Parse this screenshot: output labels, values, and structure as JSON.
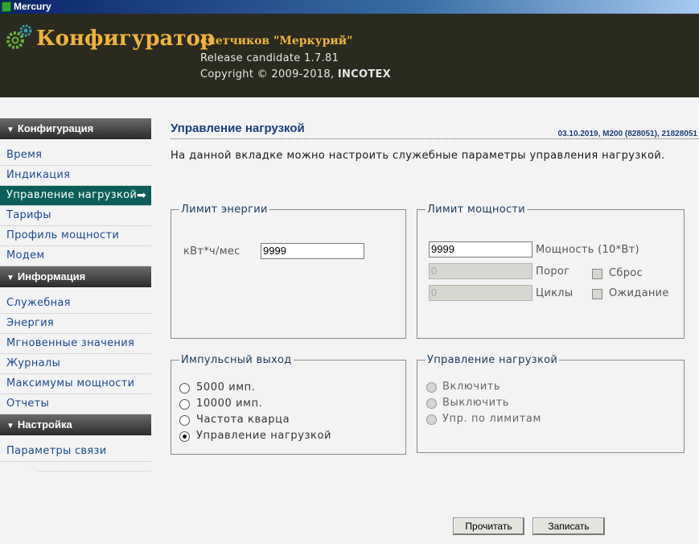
{
  "window": {
    "title": "Mercury"
  },
  "header": {
    "brand": "Конфигуратор",
    "subtitle": "счетчиков \"Меркурий\"",
    "release": "Release candidate 1.7.81",
    "copyright_prefix": "Copyright © 2009-2018, ",
    "copyright_company": "INCOTEX"
  },
  "sidebar": {
    "sections": [
      {
        "title": "Конфигурация",
        "items": [
          "Время",
          "Индикация",
          "Управление нагрузкой",
          "Тарифы",
          "Профиль мощности",
          "Модем"
        ]
      },
      {
        "title": "Информация",
        "items": [
          "Служебная",
          "Энергия",
          "Мгновенные значения",
          "Журналы",
          "Максимумы мощности",
          "Отчеты"
        ]
      },
      {
        "title": "Настройка",
        "items": [
          "Параметры связи"
        ]
      }
    ],
    "active_item": "Управление нагрузкой"
  },
  "main": {
    "title": "Управление нагрузкой",
    "meta": "03.10.2019, M200 (828051), 21828051",
    "description": "На данной вкладке можно настроить служебные параметры управления нагрузкой.",
    "energy_limit": {
      "legend": "Лимит энергии",
      "unit_label": "кВт*ч/мес",
      "value": "9999"
    },
    "power_limit": {
      "legend": "Лимит мощности",
      "power_value": "9999",
      "power_label": "Мощность (10*Вт)",
      "threshold_value": "0",
      "threshold_label": "Порог",
      "cycles_value": "0",
      "cycles_label": "Циклы",
      "reset_label": "Сброс",
      "wait_label": "Ожидание"
    },
    "pulse_output": {
      "legend": "Импульсный выход",
      "options": [
        "5000 имп.",
        "10000 имп.",
        "Частота кварца",
        "Управление нагрузкой"
      ],
      "selected": "Управление нагрузкой"
    },
    "load_control": {
      "legend": "Управление нагрузкой",
      "options": [
        "Включить",
        "Выключить",
        "Упр. по лимитам"
      ]
    },
    "buttons": {
      "read": "Прочитать",
      "write": "Записать"
    }
  },
  "colors": {
    "header_bg": "#2a2a1e",
    "brand": "#f0b33c",
    "active_nav": "#0c5e5a",
    "link": "#1a4a8a",
    "title": "#1c3f78"
  }
}
